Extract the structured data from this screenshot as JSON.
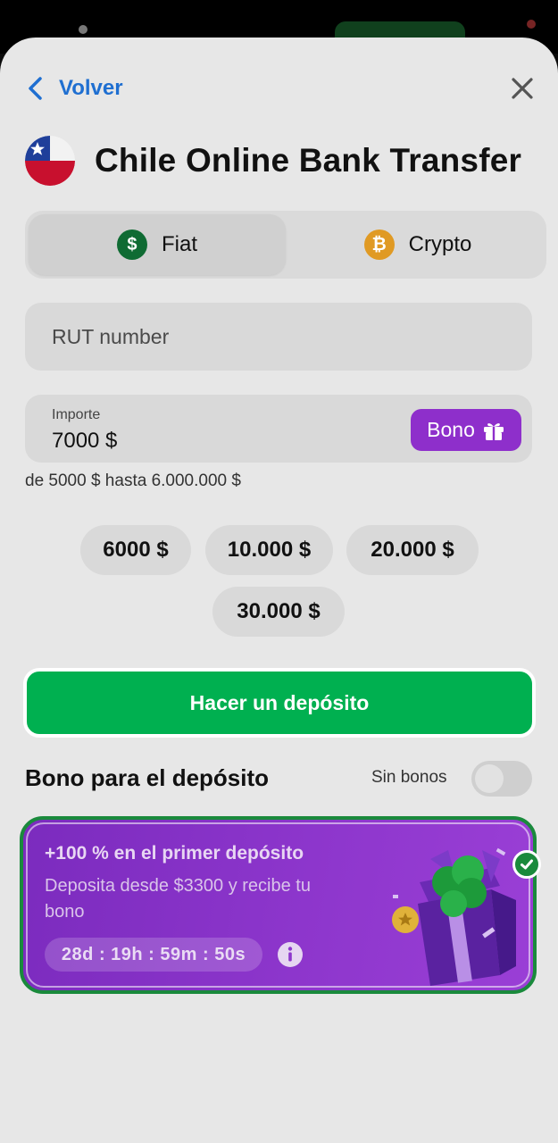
{
  "header": {
    "back_label": "Volver",
    "title": "Chile Online Bank Transfer"
  },
  "currency_tabs": [
    {
      "label": "Fiat",
      "icon": "dollar-coin-icon",
      "active": true
    },
    {
      "label": "Crypto",
      "icon": "bitcoin-icon",
      "active": false
    }
  ],
  "form": {
    "rut_placeholder": "RUT number",
    "amount_label": "Importe",
    "amount_value": "7000 $",
    "bono_label": "Bono",
    "range_text": "de 5000 $ hasta 6.000.000 $"
  },
  "quick_amounts": [
    "6000 $",
    "10.000 $",
    "20.000 $",
    "30.000 $"
  ],
  "deposit_button": "Hacer un depósito",
  "bonus": {
    "heading": "Bono para el depósito",
    "no_bonus_label": "Sin bonos",
    "no_bonus_enabled": false,
    "card": {
      "title": "+100 % en el primer depósito",
      "description": "Deposita desde $3300 y recibe tu bono",
      "timer": "28d : 19h : 59m : 50s",
      "selected": true
    }
  },
  "colors": {
    "link_blue": "#1f6fd1",
    "deposit_green": "#00b050",
    "bono_purple": "#8e2fcb",
    "card_border_green": "#1a8a3c"
  }
}
